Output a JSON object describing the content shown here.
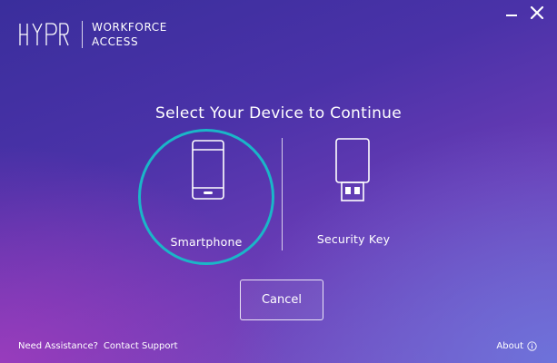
{
  "brand": {
    "line1": "WORKFORCE",
    "line2": "ACCESS"
  },
  "headline": "Select Your Device to Continue",
  "options": [
    {
      "label": "Smartphone",
      "icon": "smartphone-icon",
      "selected": true
    },
    {
      "label": "Security Key",
      "icon": "usb-key-icon",
      "selected": false
    }
  ],
  "cancel_label": "Cancel",
  "footer": {
    "assist_text": "Need Assistance?",
    "contact_link": "Contact Support",
    "about_link": "About"
  },
  "colors": {
    "accent_ring": "#1ab6c8",
    "text": "#ffffff"
  }
}
